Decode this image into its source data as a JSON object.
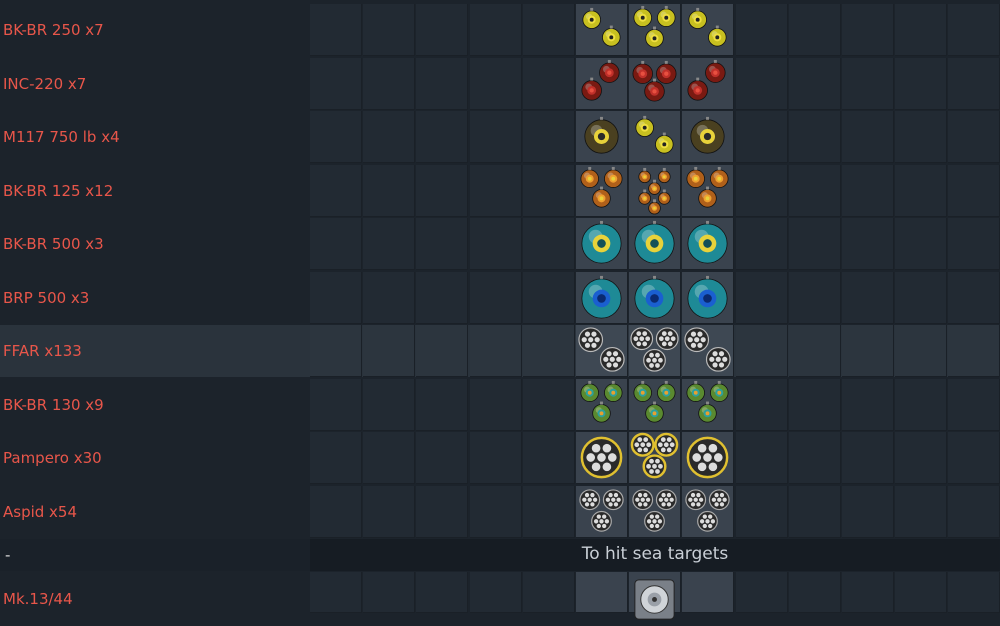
{
  "loadout_rows": [
    {
      "label": "BK-BR 250 x7",
      "icon": "bomb-yellow-icon",
      "highlight": false
    },
    {
      "label": "INC-220 x7",
      "icon": "bomb-red-icon",
      "highlight": false
    },
    {
      "label": "M117 750 lb x4",
      "icon": "bomb-dark-yellow-icon",
      "highlight": false
    },
    {
      "label": "BK-BR 125 x12",
      "icon": "bomb-orange-icon",
      "highlight": false
    },
    {
      "label": "BK-BR 500 x3",
      "icon": "bomb-teal-icon",
      "highlight": false
    },
    {
      "label": "BRP 500 x3",
      "icon": "bomb-teal-blue-icon",
      "highlight": false
    },
    {
      "label": "FFAR x133",
      "icon": "rocket-pod-icon",
      "highlight": true
    },
    {
      "label": "BK-BR 130 x9",
      "icon": "bomb-green-icon",
      "highlight": false
    },
    {
      "label": "Pampero x30",
      "icon": "rocket-launcher-gold-icon",
      "highlight": false
    },
    {
      "label": "Aspid x54",
      "icon": "rocket-pod-grey-icon",
      "highlight": false
    }
  ],
  "separator": {
    "dash": "-",
    "text": "To hit sea targets"
  },
  "last_row": {
    "label": "Mk.13/44",
    "icon": "torpedo-icon"
  },
  "colors": {
    "label": "#e8564a",
    "accent_yellow": "#e8d23a"
  }
}
